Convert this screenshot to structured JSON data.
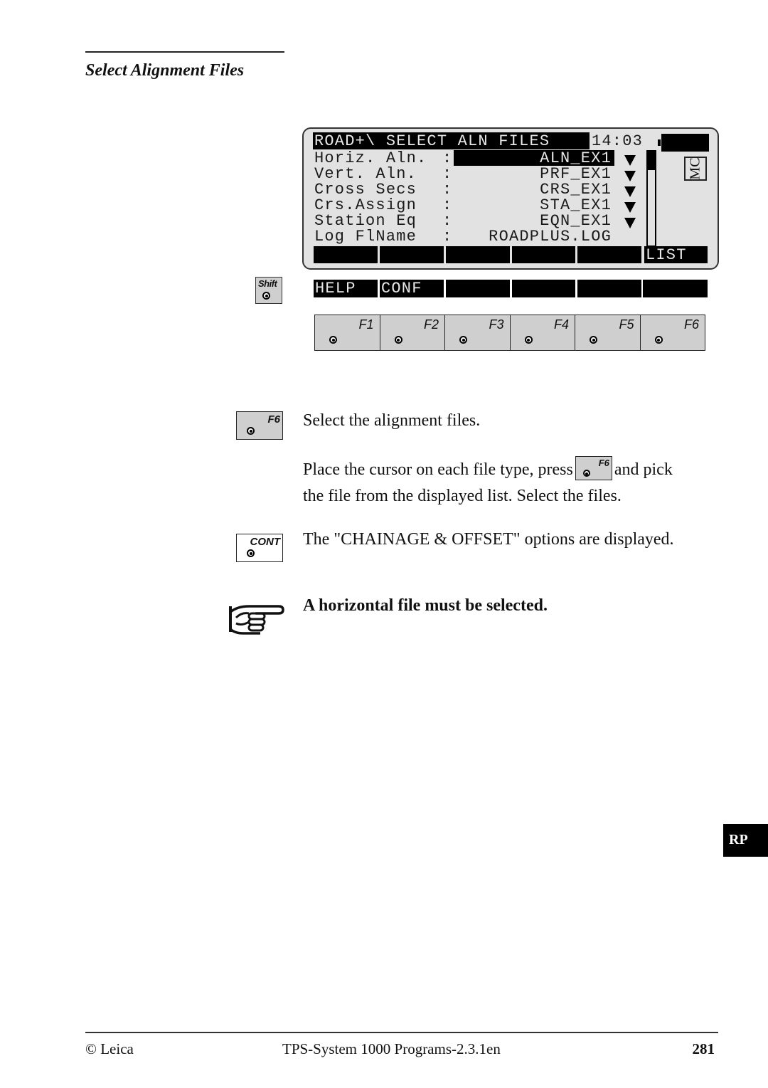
{
  "header": {
    "section_title": "Select Alignment Files"
  },
  "lcd": {
    "title": "ROAD+\\ SELECT ALN FILES",
    "time": "14:03",
    "battery_icon": "battery-icon",
    "mode_badge": "MC",
    "rows": [
      {
        "label": "Horiz. Aln.",
        "colon": ":",
        "value": "ALN_EX1",
        "has_dropdown": true,
        "selected": true
      },
      {
        "label": "Vert. Aln.",
        "colon": ":",
        "value": "PRF_EX1",
        "has_dropdown": true
      },
      {
        "label": "Cross Secs",
        "colon": ":",
        "value": "CRS_EX1",
        "has_dropdown": true
      },
      {
        "label": "Crs.Assign",
        "colon": ":",
        "value": "STA_EX1",
        "has_dropdown": true
      },
      {
        "label": "Station Eq",
        "colon": ":",
        "value": "EQN_EX1",
        "has_dropdown": true
      },
      {
        "label": "Log FlName",
        "colon": ":",
        "value": "ROADPLUS.LOG",
        "has_dropdown": false
      }
    ],
    "softkeys": [
      "",
      "",
      "",
      "",
      "",
      "LIST"
    ]
  },
  "shift_level": {
    "shift_key_label": "Shift",
    "softkeys": [
      "HELP",
      "CONF",
      "",
      "",
      "",
      ""
    ]
  },
  "function_keys": [
    "F1",
    "F2",
    "F3",
    "F4",
    "F5",
    "F6"
  ],
  "instructions": [
    {
      "key": "F6",
      "text": "Select the alignment files."
    },
    {
      "text_before": "Place the cursor on each file type, press",
      "inline_key": "F6",
      "text_after": "and pick",
      "text_line2": "the file from the displayed list. Select the files."
    },
    {
      "key": "CONT",
      "text": "The \"CHAINAGE & OFFSET\" options are displayed."
    }
  ],
  "note": {
    "icon": "pointing-hand-icon",
    "text": "A horizontal file must be selected."
  },
  "side_tab": {
    "label": "RP"
  },
  "footer": {
    "left": "© Leica",
    "center": "TPS-System 1000 Programs-2.3.1en",
    "page_number": "281"
  }
}
